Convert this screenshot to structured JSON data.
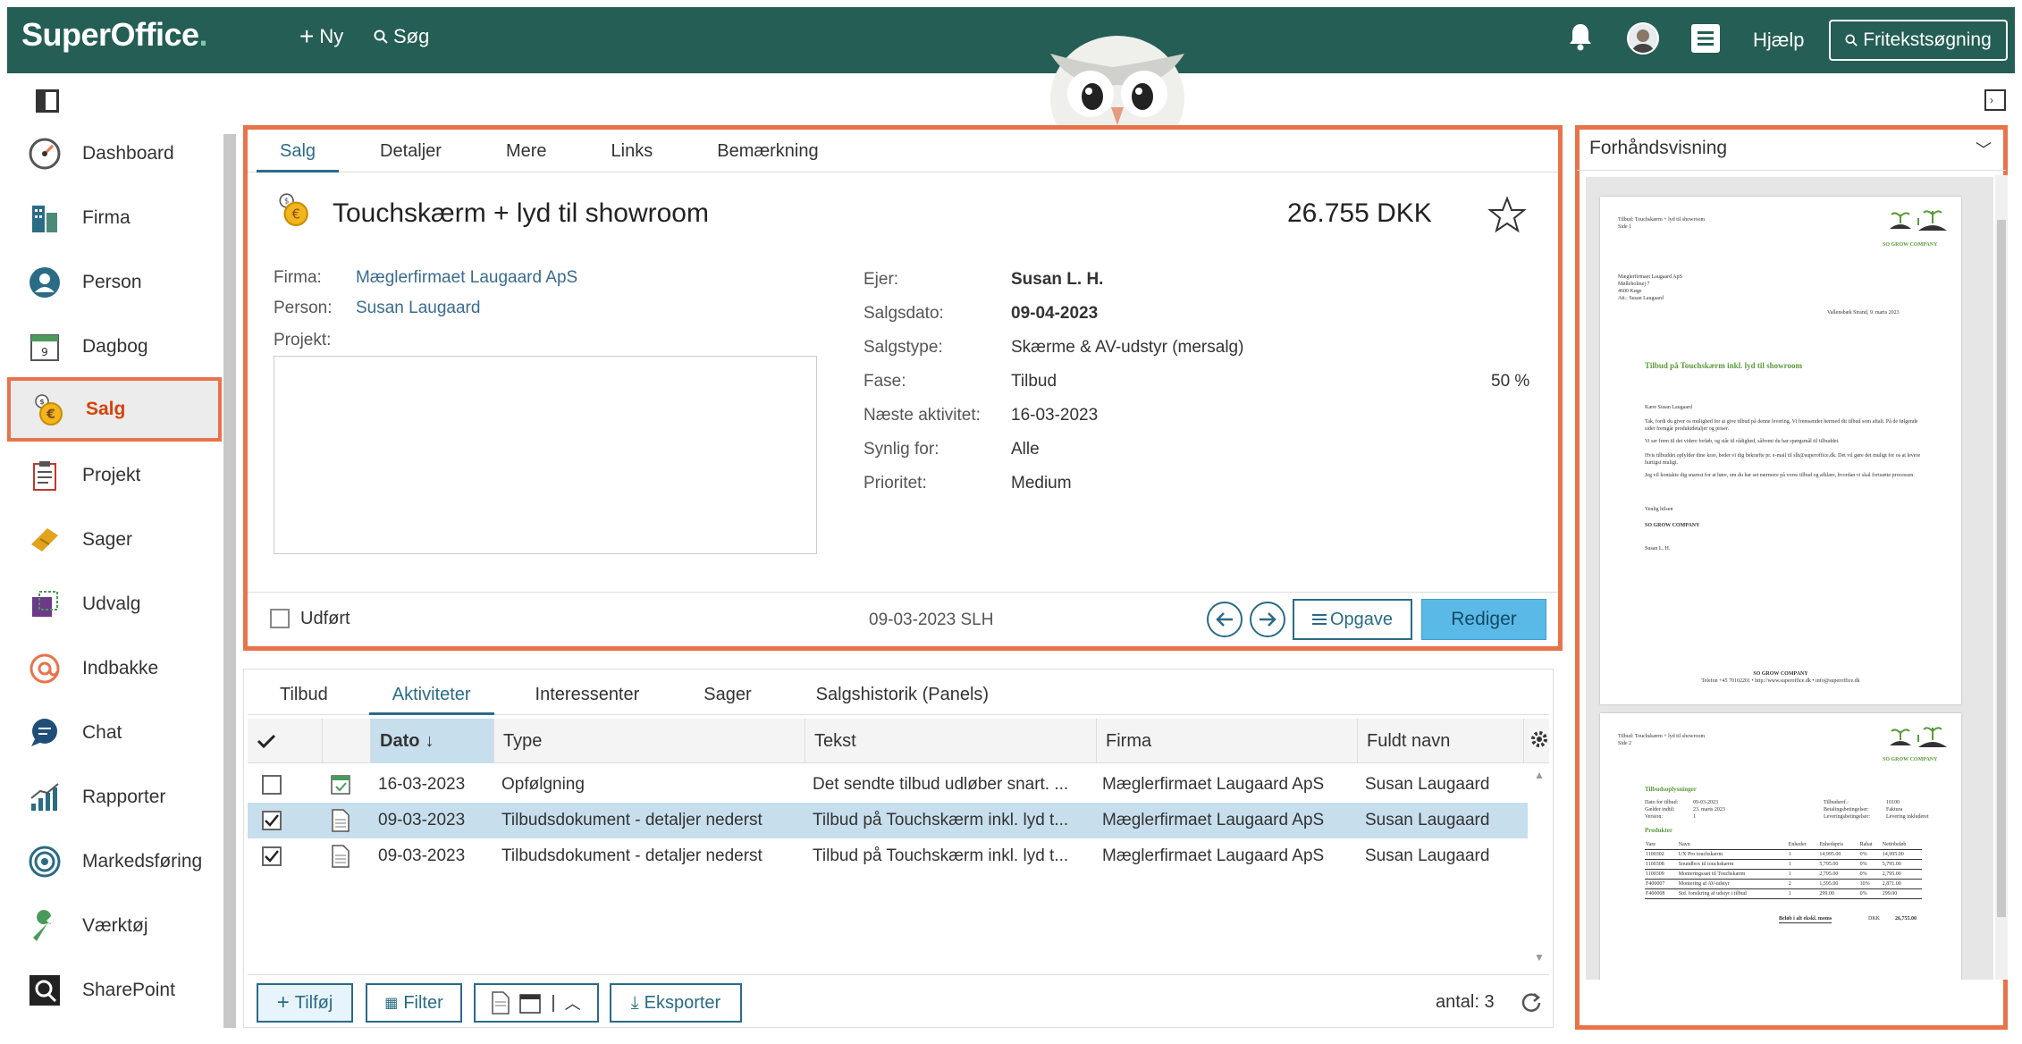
{
  "topbar": {
    "logo": "SuperOffice",
    "logo_dot": ".",
    "new_label": "Ny",
    "search_label": "Søg",
    "help_label": "Hjælp",
    "fulltext_label": "Fritekstsøgning"
  },
  "sidebar": {
    "items": [
      {
        "label": "Dashboard",
        "icon": "gauge-icon"
      },
      {
        "label": "Firma",
        "icon": "building-icon"
      },
      {
        "label": "Person",
        "icon": "person-icon"
      },
      {
        "label": "Dagbog",
        "icon": "calendar-icon"
      },
      {
        "label": "Salg",
        "icon": "coins-icon"
      },
      {
        "label": "Projekt",
        "icon": "clipboard-icon"
      },
      {
        "label": "Sager",
        "icon": "ticket-icon"
      },
      {
        "label": "Udvalg",
        "icon": "selection-icon"
      },
      {
        "label": "Indbakke",
        "icon": "at-icon"
      },
      {
        "label": "Chat",
        "icon": "chat-icon"
      },
      {
        "label": "Rapporter",
        "icon": "chart-icon"
      },
      {
        "label": "Markedsføring",
        "icon": "target-icon"
      },
      {
        "label": "Værktøj",
        "icon": "wrench-icon"
      },
      {
        "label": "SharePoint",
        "icon": "sharepoint-icon"
      }
    ]
  },
  "sale": {
    "tabs": [
      "Salg",
      "Detaljer",
      "Mere",
      "Links",
      "Bemærkning"
    ],
    "title": "Touchskærm + lyd til showroom",
    "amount": "26.755",
    "currency": "DKK",
    "left_fields": [
      {
        "label": "Firma:",
        "value": "Mæglerfirmaet Laugaard ApS"
      },
      {
        "label": "Person:",
        "value": "Susan Laugaard"
      },
      {
        "label": "Projekt:",
        "value": ""
      }
    ],
    "right_fields": [
      {
        "label": "Ejer:",
        "value": "Susan L. H."
      },
      {
        "label": "Salgsdato:",
        "value": "09-04-2023"
      },
      {
        "label": "Salgstype:",
        "value": "Skærme & AV-udstyr (mersalg)"
      },
      {
        "label": "Fase:",
        "value": "Tilbud"
      },
      {
        "label": "Næste aktivitet:",
        "value": "16-03-2023"
      },
      {
        "label": "Synlig for:",
        "value": "Alle"
      },
      {
        "label": "Prioritet:",
        "value": "Medium"
      }
    ],
    "probability": "50 %",
    "done_label": "Udført",
    "updated": "09-03-2023 SLH",
    "task_label": "Opgave",
    "edit_label": "Rediger"
  },
  "activities": {
    "tabs": [
      "Tilbud",
      "Aktiviteter",
      "Interessenter",
      "Sager",
      "Salgshistorik (Panels)"
    ],
    "columns": [
      "Dato",
      "Type",
      "Tekst",
      "Firma",
      "Fuldt navn"
    ],
    "rows": [
      {
        "checked": false,
        "date": "16-03-2023",
        "type": "Opfølgning",
        "text": "Det sendte tilbud udløber snart. ...",
        "company": "Mæglerfirmaet Laugaard ApS",
        "name": "Susan Laugaard"
      },
      {
        "checked": true,
        "date": "09-03-2023",
        "type": "Tilbudsdokument - detaljer nederst",
        "text": "Tilbud på Touchskærm inkl. lyd t...",
        "company": "Mæglerfirmaet Laugaard ApS",
        "name": "Susan Laugaard"
      },
      {
        "checked": true,
        "date": "09-03-2023",
        "type": "Tilbudsdokument - detaljer nederst",
        "text": "Tilbud på Touchskærm inkl. lyd t...",
        "company": "Mæglerfirmaet Laugaard ApS",
        "name": "Susan Laugaard"
      }
    ],
    "add_label": "Tilføj",
    "filter_label": "Filter",
    "export_label": "Eksporter",
    "count_label": "antal: 3"
  },
  "preview": {
    "title": "Forhåndsvisning",
    "page1": {
      "header": "Tilbud: Touchskærm + lyd til showroom",
      "page": "Side 1",
      "company_logo": "SO GROW COMPANY",
      "address": [
        "Mæglerfirmaet Laugaard ApS",
        "Mølleholmej 7",
        "4600 Køge",
        "Att.: Susan Laugaard"
      ],
      "place_date": "Vallensbæk Strand, 9. marts 2023",
      "heading": "Tilbud på Touchskærm inkl. lyd til showroom",
      "greeting": "Kære Susan Laugaard",
      "p1": "Tak, fordi du giver os mulighed for at give tilbud på denne levering. Vi fremsender hermed dit tilbud som aftalt. På de følgende sider fremgår produktdetaljer og priser.",
      "p2": "Vi ser frem til det videre forløb, og står til rådighed, såfremt du har spørgsmål til tilbuddet.",
      "p3": "Hvis tilbuddet opfylder dine krav, beder vi dig bekræfte pr. e-mail til slh@superoffice.dk. Det vil gøre det muligt for os at levere hurtigst muligt.",
      "p4": "Jeg vil kontakte dig snarest for at høre, om du har set nærmere på vores tilbud og afklare, hvordan vi skal fortsætte processen.",
      "closing": "Venlig hilsen",
      "company": "SO GROW COMPANY",
      "signer": "Susan L. H.",
      "footer_company": "SO GROW COMPANY",
      "footer": "Telefon +45 70102201 • http://www.superoffice.dk • info@superoffice.dk"
    },
    "page2": {
      "header": "Tilbud: Touchskærm + lyd til showroom",
      "page": "Side 2",
      "company_logo": "SO GROW COMPANY",
      "section": "Tilbudsoplysninger",
      "info_left": [
        [
          "Dato for tilbud:",
          "09-03-2023"
        ],
        [
          "Gælder indtil:",
          "23. marts 2023"
        ],
        [
          "Version:",
          "1"
        ]
      ],
      "info_right": [
        [
          "Tilbudsref.:",
          "10100"
        ],
        [
          "Betalingsbetingelser:",
          "Faktura"
        ],
        [
          "Leveringsbetingelser:",
          "Levering inkluderet"
        ]
      ],
      "products_title": "Produkter",
      "product_cols": [
        "Vare",
        "Navn",
        "Enheder",
        "Enhedspris",
        "Rabat",
        "Nettobeløb"
      ],
      "products": [
        [
          "1100302",
          "UX Pro touchskærm",
          "1",
          "14,995.00",
          "0%",
          "14,995.00"
        ],
        [
          "1100308",
          "Soundbox til touchskærm",
          "1",
          "5,795.00",
          "0%",
          "5,795.00"
        ],
        [
          "1100309",
          "Monteringssæt til Touchskærm",
          "1",
          "2,795.00",
          "0%",
          "2,795.00"
        ],
        [
          "F400007",
          "Montering af AV-udstyr",
          "2",
          "1,595.00",
          "10%",
          "2,871.00"
        ],
        [
          "F400008",
          "Std. forsikring af udstyr i tilbud",
          "1",
          "299.00",
          "0%",
          "299.00"
        ]
      ],
      "total_label": "Beløb i alt ekskl. moms",
      "total_currency": "DKK",
      "total": "26,755.00"
    }
  },
  "colors": {
    "topbar": "#245e55",
    "highlight": "#e8734a",
    "accent": "#2a6b86",
    "edit_button": "#5ab9e6"
  }
}
